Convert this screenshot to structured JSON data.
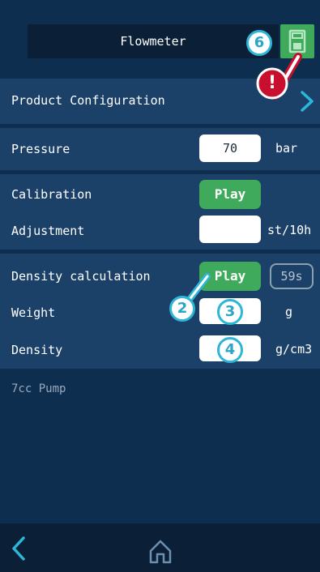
{
  "header": {
    "title": "Flowmeter",
    "save_icon": "save-floppy-icon"
  },
  "product_config": {
    "label": "Product Configuration",
    "icon": "chevron-right-icon"
  },
  "pressure": {
    "label": "Pressure",
    "value": "70",
    "unit": "bar"
  },
  "calibration": {
    "label": "Calibration",
    "button": "Play"
  },
  "adjustment": {
    "label": "Adjustment",
    "value": "",
    "unit": "st/10h"
  },
  "density_calc": {
    "label": "Density calculation",
    "button": "Play",
    "timer": "59s"
  },
  "weight": {
    "label": "Weight",
    "value": "",
    "unit": "g"
  },
  "density": {
    "label": "Density",
    "value": "",
    "unit": "g/cm3"
  },
  "pump": {
    "label": "7cc Pump"
  },
  "callouts": {
    "c2": "2",
    "c3": "3",
    "c4": "4",
    "c6": "6",
    "warning": "!"
  },
  "footer": {
    "back_icon": "chevron-left-icon",
    "home_icon": "home-icon"
  },
  "colors": {
    "background": "#0d2e4f",
    "row": "#1c4168",
    "accent": "#3faa5c",
    "callout": "#2db6d8",
    "warning": "#c8102e"
  }
}
